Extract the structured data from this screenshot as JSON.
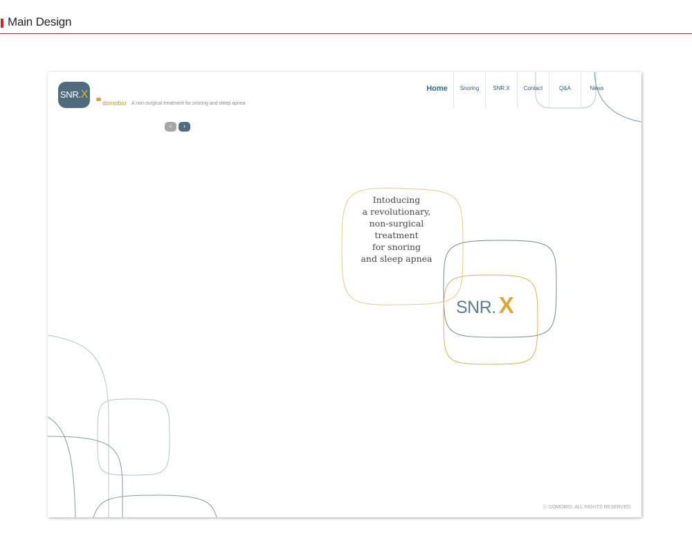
{
  "section_title": "Main Design",
  "site": {
    "logo_text": "SNR.",
    "logo_x": "X",
    "brand_name": "domobio",
    "tagline": "A non-surgical treatment for snoring and sleep apnea"
  },
  "nav": [
    {
      "label": "Home"
    },
    {
      "label": "Snoring"
    },
    {
      "label": "SNR.X"
    },
    {
      "label": "Contact"
    },
    {
      "label": "Q&A"
    },
    {
      "label": "News"
    }
  ],
  "slider": {
    "prev_icon": "chevron-left-icon",
    "next_icon": "chevron-right-icon",
    "prev_glyph": "‹",
    "next_glyph": "›"
  },
  "hero": {
    "lines": [
      "Intoducing",
      "a revolutionary,",
      "non-surgical",
      "treatment",
      "for snoring",
      "and sleep apnea"
    ],
    "logo_text": "SNR.",
    "logo_x": "X"
  },
  "footer": {
    "copyright": "ⓒ DOMOBIO. ALL RIGHTS RESERVED."
  },
  "colors": {
    "accent_red": "#d81e2a",
    "slate_blue": "#4e6c7e",
    "gold": "#d7a93a",
    "text_gray": "#444444"
  }
}
